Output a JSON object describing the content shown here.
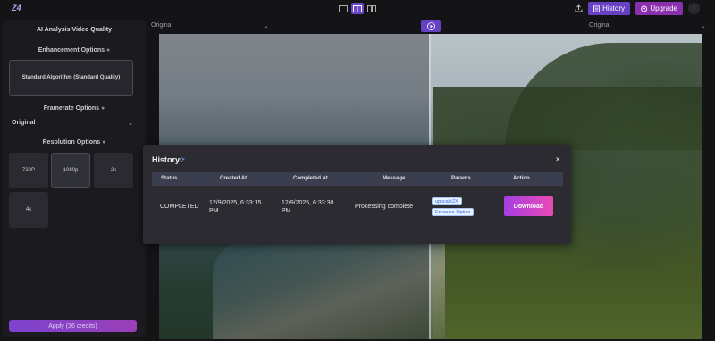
{
  "app": {
    "logo": "Z4"
  },
  "topbar": {
    "view_modes": [
      {
        "icon": "single-view-icon"
      },
      {
        "icon": "split-view-icon",
        "active": true
      },
      {
        "icon": "side-by-side-icon"
      }
    ],
    "history_label": "History",
    "upgrade_label": "Upgrade",
    "avatar_initial": "r"
  },
  "sidebar": {
    "title": "AI Analysis Video Quality",
    "enhancement_heading": "Enhancement Options",
    "algorithm_card": "Standard Algorithm (Standard Quality)",
    "framerate_heading": "Framerate Options",
    "framerate_value": "Original",
    "resolution_heading": "Resolution Options",
    "resolutions": [
      "720P",
      "1080p",
      "2k",
      "4k"
    ],
    "selected_resolution": "1080p",
    "apply_label": "Apply  (36 credits)"
  },
  "preview": {
    "left_label": "Original",
    "right_label": "Original"
  },
  "history_modal": {
    "title": "History",
    "columns": [
      "Status",
      "Created At",
      "Completed At",
      "Message",
      "Params",
      "Action"
    ],
    "rows": [
      {
        "status": "COMPLETED",
        "created_at": "12/9/2025, 6:33:15 PM",
        "completed_at": "12/9/2025, 6:33:30 PM",
        "message": "Processing complete",
        "params": [
          "upscale2X",
          "Enhance Option"
        ],
        "action": "Download"
      }
    ]
  },
  "colors": {
    "accent": "#6741c4",
    "upgrade": "#8a2fae",
    "download_gradient_start": "#a63ee0",
    "download_gradient_end": "#e94ab6"
  }
}
